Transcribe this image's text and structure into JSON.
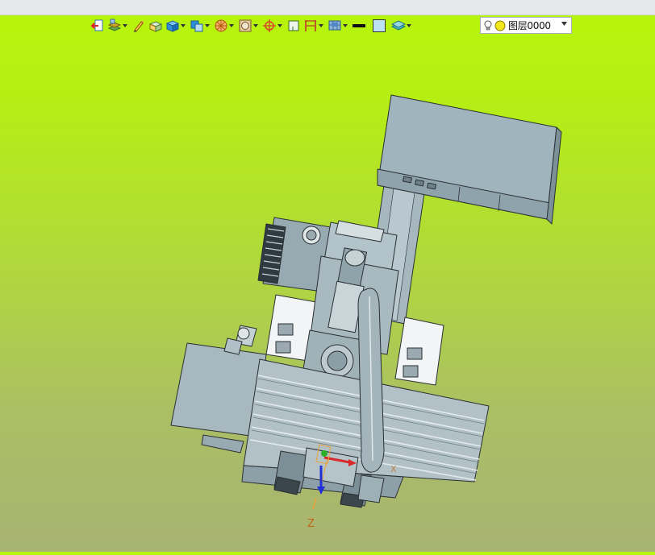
{
  "toolbar": {
    "items": [
      {
        "icon": "exit-view-icon"
      },
      {
        "icon": "layer-stack-icon",
        "dropdown": true
      },
      {
        "icon": "pencil-icon"
      },
      {
        "icon": "box-open-icon"
      },
      {
        "icon": "solid-cube-icon",
        "dropdown": true
      },
      {
        "icon": "view-cube-icon",
        "dropdown": true
      },
      {
        "icon": "render-sphere-icon",
        "dropdown": true
      },
      {
        "icon": "display-mode-icon",
        "dropdown": true
      },
      {
        "icon": "snap-target-icon",
        "dropdown": true
      },
      {
        "icon": "grid-frame-icon"
      },
      {
        "icon": "dimension-icon",
        "dropdown": true
      },
      {
        "icon": "workplane-icon",
        "dropdown": true
      },
      {
        "icon": "line-weight-icon"
      },
      {
        "icon": "color-swatch-icon"
      },
      {
        "icon": "layer-plane-icon",
        "dropdown": true
      }
    ],
    "layer": {
      "value": "图层0000",
      "icon": "lightbulb-icon",
      "color": "#f2e61c"
    }
  },
  "viewport": {
    "background_top": "#b6f60c",
    "background_bottom": "#a8b372",
    "axis": {
      "z_label": "Z",
      "x_label": "X"
    }
  }
}
